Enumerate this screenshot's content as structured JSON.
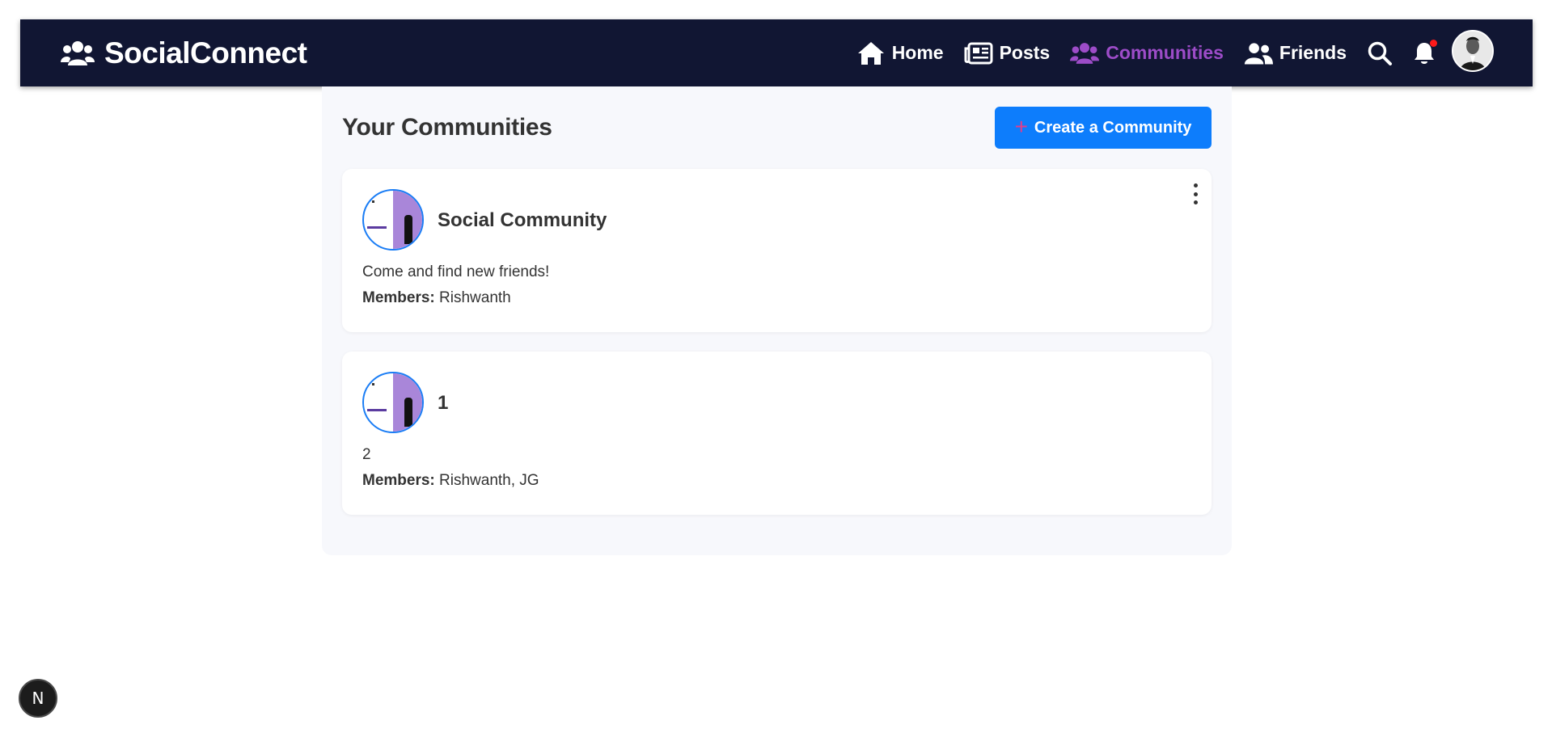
{
  "navbar": {
    "brand": "SocialConnect",
    "links": [
      {
        "label": "Home",
        "icon": "home-icon",
        "active": false
      },
      {
        "label": "Posts",
        "icon": "newspaper-icon",
        "active": false
      },
      {
        "label": "Communities",
        "icon": "users-icon",
        "active": true
      },
      {
        "label": "Friends",
        "icon": "user-friends-icon",
        "active": false
      }
    ],
    "accent_color": "#9d4cc8",
    "notification_dot_color": "#ff1a1a"
  },
  "main": {
    "title": "Your Communities",
    "create_button_label": "Create a Community",
    "communities": [
      {
        "name": "Social Community",
        "description": "Come and find new friends!",
        "members_label": "Members:",
        "members": "Rishwanth"
      },
      {
        "name": "1",
        "description": "2",
        "members_label": "Members:",
        "members": "Rishwanth, JG"
      }
    ]
  },
  "badge": {
    "label": "N"
  }
}
